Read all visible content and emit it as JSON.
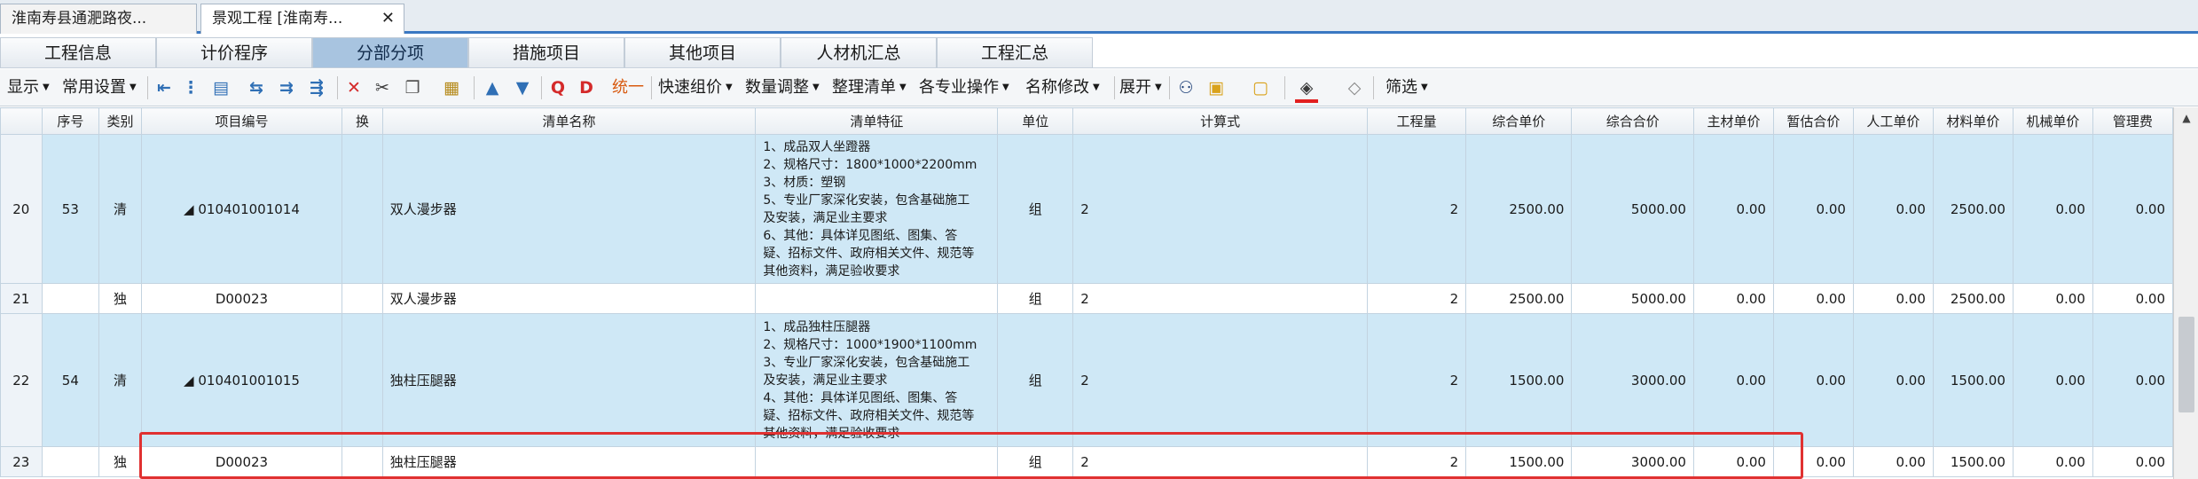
{
  "doc_tabs": [
    {
      "label": "淮南寿县通淝路夜..."
    },
    {
      "label": "景观工程 [淮南寿...",
      "close": "✕"
    }
  ],
  "page_tabs": [
    "工程信息",
    "计价程序",
    "分部分项",
    "措施项目",
    "其他项目",
    "人材机汇总",
    "工程汇总"
  ],
  "active_page_tab": 2,
  "toolbar": {
    "display": "显示",
    "common_settings": "常用设置",
    "unify": "统一",
    "quick_price": "快速组价",
    "qty_adjust": "数量调整",
    "organize_list": "整理清单",
    "specialty_ops": "各专业操作",
    "rename": "名称修改",
    "expand": "展开",
    "filter": "筛选"
  },
  "columns": [
    "",
    "序号",
    "类别",
    "项目编号",
    "换",
    "清单名称",
    "清单特征",
    "单位",
    "计算式",
    "工程量",
    "综合单价",
    "综合合价",
    "主材单价",
    "暂估合价",
    "人工单价",
    "材料单价",
    "机械单价",
    "管理费"
  ],
  "rows": [
    {
      "row": "20",
      "seq": "53",
      "type": "清",
      "code": "◢ 010401001014",
      "swap": "",
      "name": "双人漫步器",
      "features": "1、成品双人坐蹬器\n2、规格尺寸：1800*1000*2200mm\n3、材质：塑钢\n5、专业厂家深化安装，包含基础施工\n及安装，满足业主要求\n6、其他：具体详见图纸、图集、答\n疑、招标文件、政府相关文件、规范等\n其他资料，满足验收要求",
      "unit": "组",
      "formula": "2",
      "qty": "2",
      "unit_price": "2500.00",
      "total": "5000.00",
      "main_mat": "0.00",
      "est_total": "0.00",
      "labor": "0.00",
      "material": "2500.00",
      "machine": "0.00",
      "mgmt": "0.00"
    },
    {
      "row": "21",
      "seq": "",
      "type": "独",
      "code": "D00023",
      "swap": "",
      "name": "双人漫步器",
      "features": "",
      "unit": "组",
      "formula": "2",
      "qty": "2",
      "unit_price": "2500.00",
      "total": "5000.00",
      "main_mat": "0.00",
      "est_total": "0.00",
      "labor": "0.00",
      "material": "2500.00",
      "machine": "0.00",
      "mgmt": "0.00"
    },
    {
      "row": "22",
      "seq": "54",
      "type": "清",
      "code": "◢ 010401001015",
      "swap": "",
      "name": "独柱压腿器",
      "features": "1、成品独柱压腿器\n2、规格尺寸：1000*1900*1100mm\n3、专业厂家深化安装，包含基础施工\n及安装，满足业主要求\n4、其他：具体详见图纸、图集、答\n疑、招标文件、政府相关文件、规范等\n其他资料，满足验收要求",
      "unit": "组",
      "formula": "2",
      "qty": "2",
      "unit_price": "1500.00",
      "total": "3000.00",
      "main_mat": "0.00",
      "est_total": "0.00",
      "labor": "0.00",
      "material": "1500.00",
      "machine": "0.00",
      "mgmt": "0.00"
    },
    {
      "row": "23",
      "seq": "",
      "type": "独",
      "code": "D00023",
      "swap": "",
      "name": "独柱压腿器",
      "features": "",
      "unit": "组",
      "formula": "2",
      "qty": "2",
      "unit_price": "1500.00",
      "total": "3000.00",
      "main_mat": "0.00",
      "est_total": "0.00",
      "labor": "0.00",
      "material": "1500.00",
      "machine": "0.00",
      "mgmt": "0.00"
    }
  ],
  "colors": {
    "qing_row": "#cfe8f6",
    "active_tab": "#a8c4e0",
    "highlight": "#e03131",
    "accent": "#3a78c2"
  },
  "icons": [
    "collapse-tree-icon",
    "insert-icon",
    "paste-icon",
    "indent-left-icon",
    "indent-right-icon",
    "merge-icon",
    "delete-icon",
    "cut-icon",
    "copy-icon",
    "paste-special-icon",
    "move-up-icon",
    "move-down-icon",
    "q-find-icon",
    "d-icon",
    "binoculars-icon",
    "lock-icon",
    "unlock-icon",
    "fill-color-icon",
    "eraser-icon"
  ]
}
